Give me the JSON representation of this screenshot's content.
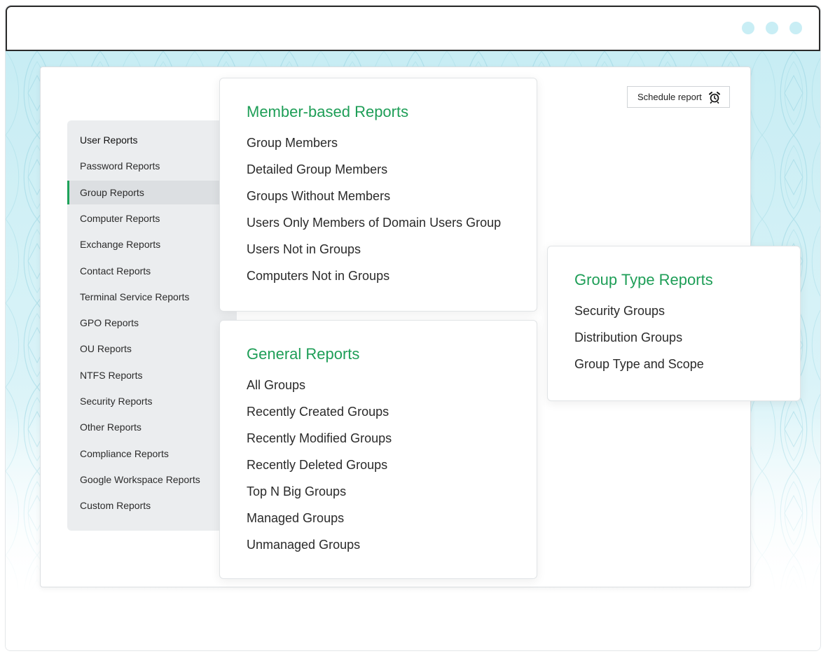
{
  "window": {
    "dots_color": "#c9eef5"
  },
  "schedule": {
    "label": "Schedule report",
    "icon": "alarm-clock-icon"
  },
  "sidebar": {
    "accent": "#1ea25a",
    "items": [
      {
        "label": "User Reports"
      },
      {
        "label": "Password Reports"
      },
      {
        "label": "Group Reports",
        "active": true
      },
      {
        "label": "Computer Reports"
      },
      {
        "label": "Exchange Reports"
      },
      {
        "label": "Contact Reports"
      },
      {
        "label": "Terminal Service Reports"
      },
      {
        "label": "GPO Reports"
      },
      {
        "label": "OU Reports"
      },
      {
        "label": "NTFS Reports"
      },
      {
        "label": "Security Reports"
      },
      {
        "label": "Other Reports"
      },
      {
        "label": "Compliance Reports"
      },
      {
        "label": "Google Workspace Reports"
      },
      {
        "label": "Custom Reports"
      }
    ]
  },
  "member_panel": {
    "title": "Member-based Reports",
    "links": [
      "Group Members",
      "Detailed Group Members",
      "Groups Without Members",
      "Users Only Members of Domain Users Group",
      "Users Not in Groups",
      "Computers Not in Groups"
    ]
  },
  "general_panel": {
    "title": "General Reports",
    "links": [
      "All Groups",
      "Recently Created Groups",
      "Recently Modified Groups",
      "Recently Deleted Groups",
      "Top N Big Groups",
      "Managed Groups",
      "Unmanaged Groups"
    ]
  },
  "type_panel": {
    "title": "Group Type Reports",
    "links": [
      "Security Groups",
      "Distribution Groups",
      "Group Type and Scope"
    ]
  },
  "colors": {
    "title_green": "#1e9e57",
    "background_teal": "#c8edf4"
  }
}
